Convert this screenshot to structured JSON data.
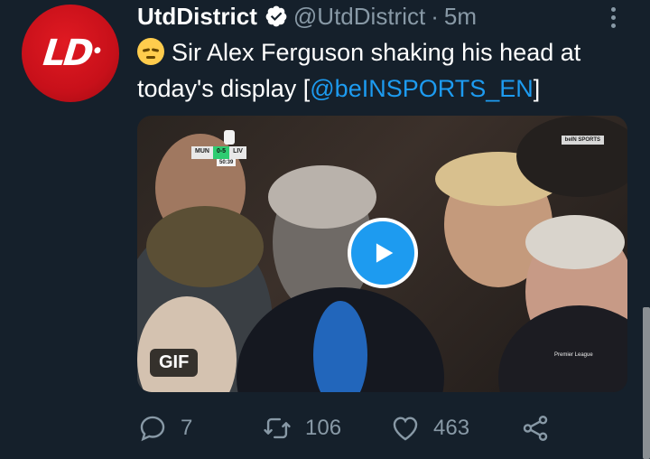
{
  "tweet": {
    "display_name": "UtdDistrict",
    "handle": "@UtdDistrict",
    "separator": "·",
    "time": "5m",
    "avatar_text": "LD",
    "text_body": "Sir Alex Ferguson shaking his head at today's display [",
    "mention": "@beINSPORTS_EN",
    "text_end": "]",
    "emoji": "pensive-face-icon"
  },
  "media": {
    "badge": "GIF",
    "scoreboard": {
      "home": "MUN",
      "score": "0-5",
      "away": "LIV",
      "clock": "50:39"
    },
    "broadcaster": "beIN SPORTS",
    "league_logo": "Premier League"
  },
  "actions": {
    "replies": "7",
    "retweets": "106",
    "likes": "463"
  },
  "colors": {
    "background": "#15202b",
    "accent": "#1d9bf0",
    "muted": "#8899a6"
  }
}
